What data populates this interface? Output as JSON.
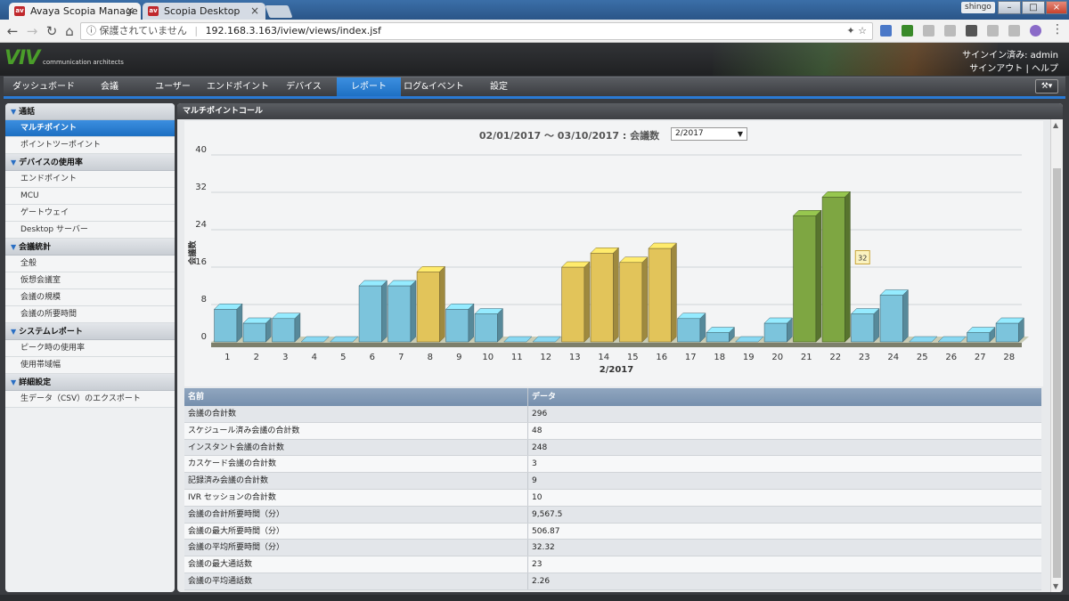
{
  "browser": {
    "tabs": [
      {
        "title": "Avaya Scopia Manage",
        "favicon": "avaya-icon"
      },
      {
        "title": "Scopia Desktop",
        "favicon": "avaya-icon"
      }
    ],
    "profile": "shingo",
    "security": "保護されていません",
    "url": "192.168.3.163/iview/views/index.jsf"
  },
  "app": {
    "logo": "VIV",
    "logo_text": "communication architects",
    "signin": "サインイン済み: admin",
    "signout": "サインアウト",
    "help": "ヘルプ",
    "menu": [
      "ダッシュボード",
      "会議",
      "ユーザー",
      "エンドポイント",
      "デバイス",
      "レポート",
      "ログ&イベント",
      "設定"
    ],
    "active_menu": "レポート"
  },
  "sidebar": {
    "sections": [
      {
        "title": "通話",
        "items": [
          "マルチポイント",
          "ポイントツーポイント"
        ]
      },
      {
        "title": "デバイスの使用率",
        "items": [
          "エンドポイント",
          "MCU",
          "ゲートウェイ",
          "Desktop サーバー"
        ]
      },
      {
        "title": "会議統計",
        "items": [
          "全般",
          "仮想会議室",
          "会議の規模",
          "会議の所要時間"
        ]
      },
      {
        "title": "システムレポート",
        "items": [
          "ピーク時の使用率",
          "使用帯域幅"
        ]
      },
      {
        "title": "詳細設定",
        "items": [
          "生データ（CSV）のエクスポート"
        ]
      }
    ],
    "active_item": "マルチポイント"
  },
  "panel": {
    "title": "マルチポイントコール",
    "date_range": "02/01/2017 ～ 03/10/2017 : 会議数",
    "period_select": "2/2017"
  },
  "chart_data": {
    "type": "bar",
    "ylabel": "会議数",
    "xlabel": "2/2017",
    "ylim": [
      0,
      40
    ],
    "yticks": [
      0,
      8,
      16,
      24,
      32,
      40
    ],
    "categories": [
      "1",
      "2",
      "3",
      "4",
      "5",
      "6",
      "7",
      "8",
      "9",
      "10",
      "11",
      "12",
      "13",
      "14",
      "15",
      "16",
      "17",
      "18",
      "19",
      "20",
      "21",
      "22",
      "23",
      "24",
      "25",
      "26",
      "27",
      "28"
    ],
    "values": [
      7,
      4,
      5,
      0,
      0,
      12,
      12,
      15,
      7,
      6,
      0,
      0,
      16,
      19,
      17,
      20,
      5,
      2,
      0,
      4,
      27,
      31,
      6,
      10,
      0,
      0,
      2,
      4
    ],
    "bar_colors": [
      "blue",
      "blue",
      "blue",
      "blue",
      "blue",
      "blue",
      "blue",
      "yellow",
      "blue",
      "blue",
      "blue",
      "blue",
      "yellow",
      "yellow",
      "yellow",
      "yellow",
      "blue",
      "blue",
      "blue",
      "blue",
      "green",
      "green",
      "blue",
      "blue",
      "blue",
      "blue",
      "blue",
      "blue"
    ],
    "colors": {
      "blue": "#7cc4dc",
      "yellow": "#e2c45a",
      "green": "#7ea642"
    },
    "tooltip": "32"
  },
  "table": {
    "headers": [
      "名前",
      "データ"
    ],
    "rows": [
      [
        "会議の合計数",
        "296"
      ],
      [
        "スケジュール済み会議の合計数",
        "48"
      ],
      [
        "インスタント会議の合計数",
        "248"
      ],
      [
        "カスケード会議の合計数",
        "3"
      ],
      [
        "記録済み会議の合計数",
        "9"
      ],
      [
        "IVR セッションの合計数",
        "10"
      ],
      [
        "会議の合計所要時間（分）",
        "9,567.5"
      ],
      [
        "会議の最大所要時間（分）",
        "506.87"
      ],
      [
        "会議の平均所要時間（分）",
        "32.32"
      ],
      [
        "会議の最大通話数",
        "23"
      ],
      [
        "会議の平均通話数",
        "2.26"
      ]
    ]
  }
}
